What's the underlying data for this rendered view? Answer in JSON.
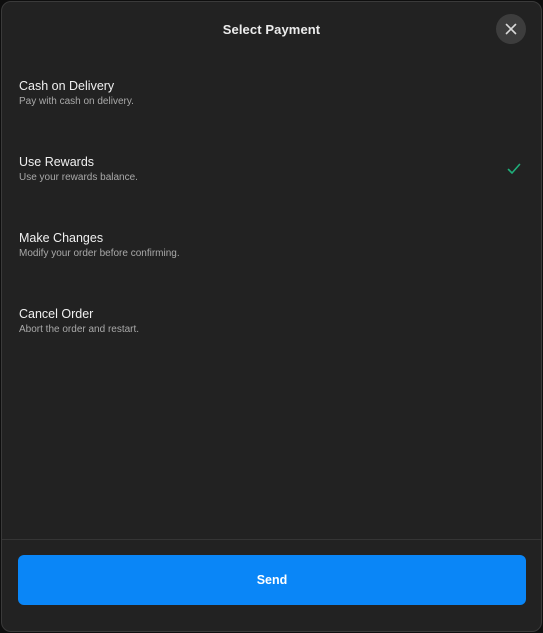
{
  "dialog": {
    "title": "Select Payment",
    "close_icon": "close-icon"
  },
  "options": [
    {
      "label": "Cash on Delivery",
      "description": "Pay with cash on delivery.",
      "selected": false
    },
    {
      "label": "Use Rewards",
      "description": "Use your rewards balance.",
      "selected": true
    },
    {
      "label": "Make Changes",
      "description": "Modify your order before confirming.",
      "selected": false
    },
    {
      "label": "Cancel Order",
      "description": "Abort the order and restart.",
      "selected": false
    }
  ],
  "footer": {
    "send_label": "Send"
  },
  "colors": {
    "background": "#222222",
    "accent": "#0a86f7",
    "check": "#1fae7a"
  }
}
